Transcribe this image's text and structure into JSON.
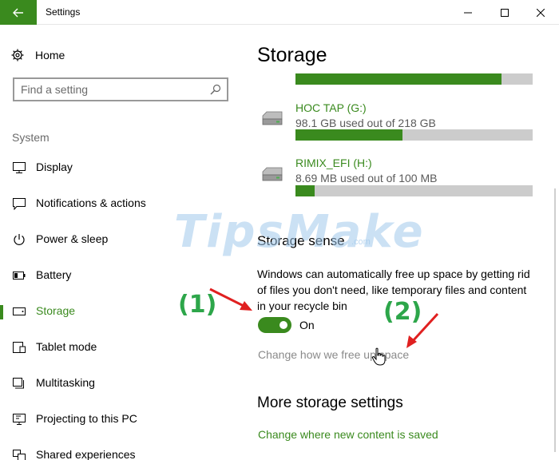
{
  "window": {
    "title": "Settings",
    "accent": "#3a8a1e"
  },
  "sidebar": {
    "home_label": "Home",
    "search_placeholder": "Find a setting",
    "section_label": "System",
    "items": [
      {
        "label": "Display",
        "icon": "monitor-icon"
      },
      {
        "label": "Notifications & actions",
        "icon": "speech-bubble-icon"
      },
      {
        "label": "Power & sleep",
        "icon": "power-icon"
      },
      {
        "label": "Battery",
        "icon": "battery-icon"
      },
      {
        "label": "Storage",
        "icon": "drive-icon",
        "active": true
      },
      {
        "label": "Tablet mode",
        "icon": "tablet-icon"
      },
      {
        "label": "Multitasking",
        "icon": "multitask-icon"
      },
      {
        "label": "Projecting to this PC",
        "icon": "project-icon"
      },
      {
        "label": "Shared experiences",
        "icon": "shared-icon"
      }
    ]
  },
  "main": {
    "title": "Storage",
    "top_bar_fill": 0.87,
    "drives": [
      {
        "name": "HOC TAP (G:)",
        "usage": "98.1 GB used out of 218 GB",
        "fill": 0.45
      },
      {
        "name": "RIMIX_EFI (H:)",
        "usage": "8.69 MB used out of 100 MB",
        "fill": 0.08
      }
    ],
    "storage_sense": {
      "heading": "Storage sense",
      "description": "Windows can automatically free up space by getting rid of files you don't need, like temporary files and content in your recycle bin",
      "toggle_state": "On",
      "change_link": "Change how we free up space"
    },
    "more_settings": {
      "heading": "More storage settings",
      "new_content_link": "Change where new content is saved"
    }
  },
  "overlay": {
    "watermark": "TipsMake",
    "watermark_suffix": ".com",
    "annotation_1": "(1)",
    "annotation_2": "(2)"
  }
}
